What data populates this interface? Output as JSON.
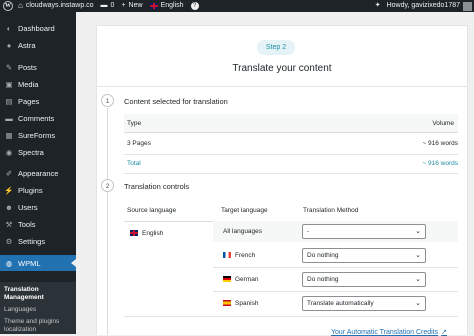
{
  "admin_bar": {
    "site_name": "cloudways.instawp.co",
    "comments_count": "0",
    "new_label": "New",
    "language": "English",
    "greeting": "Howdy, gavizixedo1787"
  },
  "sidebar": {
    "items": [
      {
        "label": "Dashboard",
        "icon": "dashboard-icon",
        "glyph": "◐"
      },
      {
        "label": "Astra",
        "icon": "astra-icon",
        "glyph": "●"
      },
      {
        "label": "Posts",
        "icon": "pin-icon",
        "glyph": "✎"
      },
      {
        "label": "Media",
        "icon": "media-icon",
        "glyph": "▣"
      },
      {
        "label": "Pages",
        "icon": "pages-icon",
        "glyph": "▤"
      },
      {
        "label": "Comments",
        "icon": "comment-icon",
        "glyph": "▬"
      },
      {
        "label": "SureForms",
        "icon": "sureforms-icon",
        "glyph": "▦"
      },
      {
        "label": "Spectra",
        "icon": "spectra-icon",
        "glyph": "◉"
      },
      {
        "label": "Appearance",
        "icon": "brush-icon",
        "glyph": "✐"
      },
      {
        "label": "Plugins",
        "icon": "plugin-icon",
        "glyph": "⚡"
      },
      {
        "label": "Users",
        "icon": "users-icon",
        "glyph": "☻"
      },
      {
        "label": "Tools",
        "icon": "tools-icon",
        "glyph": "⚒"
      },
      {
        "label": "Settings",
        "icon": "settings-icon",
        "glyph": "⚙"
      },
      {
        "label": "WPML",
        "icon": "wpml-icon",
        "glyph": "◍"
      }
    ],
    "submenu": {
      "translation_management": "Translation Management",
      "languages": "Languages",
      "theme_plugins": "Theme and plugins localization"
    }
  },
  "main": {
    "step_pill": "Step 2",
    "title": "Translate your content",
    "section1": {
      "number": "1",
      "title": "Content selected for translation",
      "col_type": "Type",
      "col_volume": "Volume",
      "row_type": "3 Pages",
      "row_volume": "~ 916 words",
      "total_label": "Total",
      "total_volume": "~ 916 words"
    },
    "section2": {
      "number": "2",
      "title": "Translation controls",
      "col_source": "Source language",
      "col_target": "Target language",
      "col_method": "Translation Method",
      "source_language": "English",
      "all_languages_label": "All languages",
      "all_languages_value": "-",
      "rows": [
        {
          "language": "French",
          "method": "Do nothing"
        },
        {
          "language": "German",
          "method": "Do nothing"
        },
        {
          "language": "Spanish",
          "method": "Translate automatically"
        }
      ]
    },
    "credits_link": "Your Automatic Translation Credits"
  }
}
